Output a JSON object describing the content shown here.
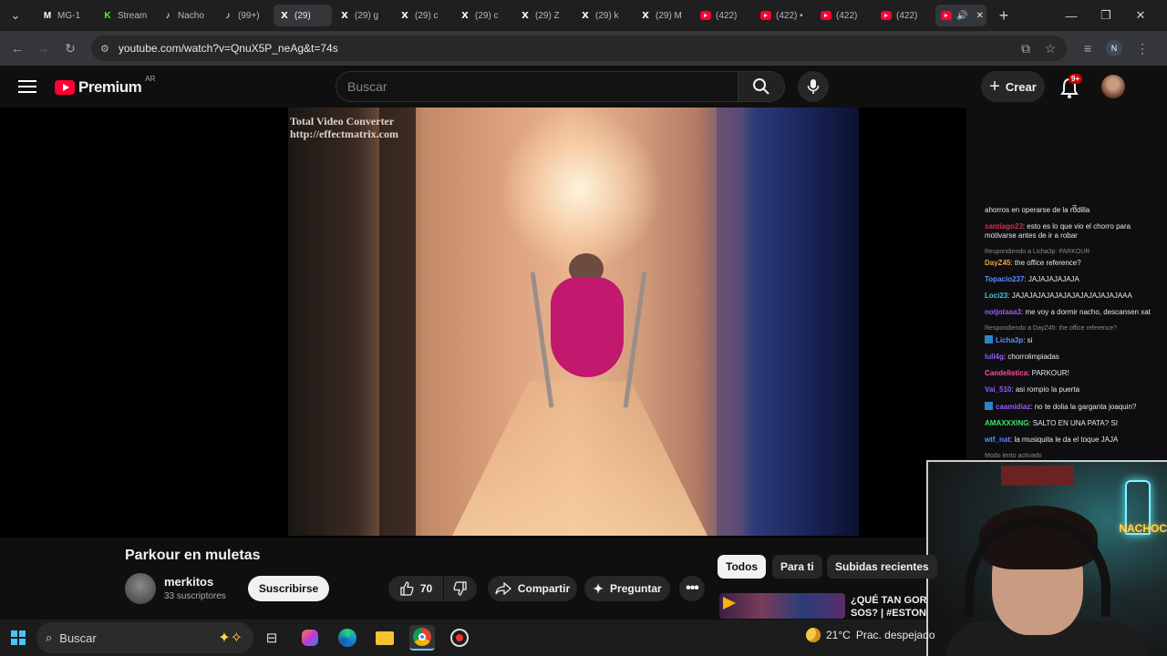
{
  "browser": {
    "tabs": [
      {
        "label": "MG-1",
        "icon": "mg-icon"
      },
      {
        "label": "Stream",
        "icon": "kick-icon"
      },
      {
        "label": "Nacho",
        "icon": "tiktok-icon"
      },
      {
        "label": "(99+)",
        "icon": "tiktok-icon"
      },
      {
        "label": "(29)",
        "icon": "x-icon"
      },
      {
        "label": "(29) g",
        "icon": "x-icon"
      },
      {
        "label": "(29) c",
        "icon": "x-icon"
      },
      {
        "label": "(29) c",
        "icon": "x-icon"
      },
      {
        "label": "(29) Z",
        "icon": "x-icon"
      },
      {
        "label": "(29) k",
        "icon": "x-icon"
      },
      {
        "label": "(29) M",
        "icon": "x-icon"
      },
      {
        "label": "(422)",
        "icon": "youtube-icon"
      },
      {
        "label": "(422) •",
        "icon": "youtube-icon"
      },
      {
        "label": "(422)",
        "icon": "youtube-icon"
      },
      {
        "label": "(422)",
        "icon": "youtube-icon"
      }
    ],
    "url": "youtube.com/watch?v=QnuX5P_neAg&t=74s",
    "profile_initial": "N"
  },
  "youtube": {
    "logo_text": "Premium",
    "region": "AR",
    "search_placeholder": "Buscar",
    "create_label": "Crear",
    "notifications_badge": "9+"
  },
  "video": {
    "watermark_line1": "Total Video Converter",
    "watermark_line2": "http://effectmatrix.com",
    "title": "Parkour en muletas",
    "channel": "merkitos",
    "subscribers": "33 suscriptores",
    "subscribe_label": "Suscribirse",
    "likes": "70",
    "share_label": "Compartir",
    "ask_label": "Preguntar"
  },
  "chips": [
    "Todos",
    "Para ti",
    "Subidas recientes"
  ],
  "recommendation": {
    "title_line1": "¿QUÉ TAN GORD",
    "title_line2": "SOS? | #ESTONC"
  },
  "chat": {
    "messages": [
      {
        "user": "",
        "text": "ahorros en operarse de la rodilla",
        "color": "#e8e8e8"
      },
      {
        "user": "santiago23",
        "text": ": esto es lo que vio el chorro para motivarse antes de ir a robar",
        "color": "#d03050"
      },
      {
        "reply": "Respondiendo a Licha3p: PARKOUR"
      },
      {
        "user": "DayZ45",
        "text": ": the office reference?",
        "color": "#e7a23a"
      },
      {
        "user": "Topacio237",
        "text": ": JAJAJAJAJAJA",
        "color": "#5b8cff"
      },
      {
        "user": "Loci23",
        "text": ": JAJAJAJAJAJAJAJAJAJAJAJAJAAA",
        "color": "#47c6d8"
      },
      {
        "user": "notjotaaa3",
        "text": ": me voy a dormir nacho, descansen xat",
        "color": "#9b59ff"
      },
      {
        "reply": "Respondiendo a DayZ45: the office reference?"
      },
      {
        "user": "Licha3p",
        "text": ": si",
        "color": "#5b8cff",
        "badge": true
      },
      {
        "user": "luli4g",
        "text": ": chorrolimpiadas",
        "color": "#9b59ff"
      },
      {
        "user": "Candelistica",
        "text": ": PARKOUR!",
        "color": "#ff4fa3"
      },
      {
        "user": "Vai_510",
        "text": ": asi rompio la puerta",
        "color": "#9b59ff"
      },
      {
        "user": "caamidiaz",
        "text": ": no te dolia la garganta joaquin?",
        "color": "#9b59ff",
        "badge": true
      },
      {
        "user": "AMAXXXING",
        "text": ": SALTO EN UNA PATA? SI",
        "color": "#3ee06a"
      },
      {
        "user": "wtf_nat",
        "text": ": la musiquita le da el toque JAJA",
        "color": "#5b8cff"
      },
      {
        "reply": "Modo lento activado"
      }
    ]
  },
  "webcam": {
    "neon_text": "NACHOC"
  },
  "taskbar": {
    "search_placeholder": "Buscar",
    "temperature": "21°C",
    "weather": "Prac. despejado"
  }
}
